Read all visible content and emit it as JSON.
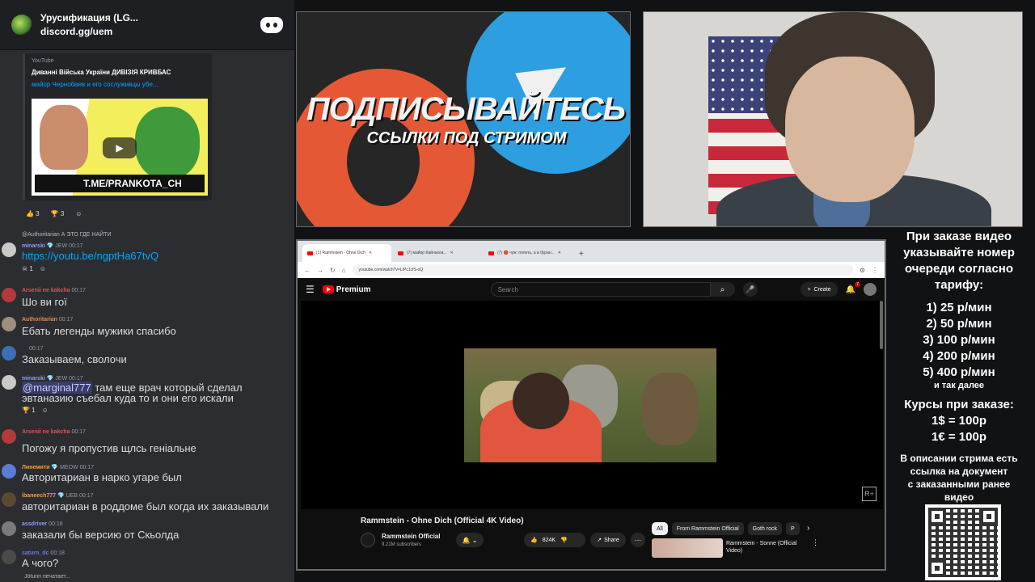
{
  "discord": {
    "server_name": "Урусификация (LG...",
    "server_link": "discord.gg/uem",
    "embed": {
      "source": "YouTube",
      "title": "Диванні Війська України ДИВІЗІЯ КРИВБАС",
      "description": "майор Чернобаев и его сослуживцы убе...",
      "banner_text": "T.ME/PRANKOTA_CH"
    },
    "embed_reactions": [
      "👍 3",
      "🏆 3",
      "☺"
    ],
    "messages": [
      {
        "reply": "@Authoritarian А ЭТО ГДЕ НАЙТИ",
        "user": "minarski",
        "badge": "💎 JEW",
        "time": "00:17",
        "text_link": "https://youtu.be/ngptHa67tvQ",
        "reactions": [
          "☠ 1",
          "☺"
        ]
      },
      {
        "user": "Arsenii ne kakcha",
        "time": "00:17",
        "text": "Шо ви гої"
      },
      {
        "user": "Authoritarian",
        "time": "00:17",
        "text": "Ебать легенды мужики спасибо"
      },
      {
        "user": "",
        "time": "00:17",
        "text": "Заказываем, сволочи"
      },
      {
        "user": "minarski",
        "badge": "💎 JEW",
        "time": "00:17",
        "mention": "@marginal777",
        "text": " там еще врач который сделал эвтаназию съебал куда то и они его искали",
        "reactions": [
          "🏆 1",
          "☺"
        ]
      },
      {
        "user": "Arsenii ne kakcha",
        "time": "00:17",
        "text": "Погожу я пропустив щлсь геніальне"
      },
      {
        "user": "Линемити",
        "badge": "💎 MEOW",
        "time": "00:17",
        "text": "Авторитариан в нарко угаре был"
      },
      {
        "user": "ibaneech777",
        "badge": "💎 UEB",
        "time": "00:17",
        "text": "авторитариан в роддоме был когда их заказывали"
      },
      {
        "user": "assdriver",
        "time": "00:18",
        "text": "заказали бы версию от Скьолда"
      },
      {
        "user": "saturn_dc",
        "time": "00:18",
        "text": "А чого?"
      }
    ],
    "typing": "Jötunn печатает..."
  },
  "banner": {
    "title": "ПОДПИСЫВАЙТЕСЬ",
    "subtitle": "ССЫЛКИ ПОД СТРИМОМ"
  },
  "browser": {
    "tabs": [
      "(1) Rammstein - Ohne Dich",
      "(7) майор Кайнахов...",
      "(7) 🔴 чуж: попеть, а в буран..."
    ],
    "url": "youtube.com/watch?v=LIPc1cfS-oQ",
    "yt": {
      "logo": "Premium",
      "search_placeholder": "Search",
      "create": "Create",
      "notif_count": "7",
      "video_title": "Rammstein - Ohne Dich (Official 4K Video)",
      "channel": "Rammstein Official",
      "subscribers": "9.21M subscribers",
      "likes": "824K",
      "share": "Share",
      "chips": [
        "All",
        "From Rammstein Official",
        "Goth rock",
        "P"
      ],
      "rec_title": "Rammstein - Sonne (Official Video)"
    }
  },
  "info": {
    "intro": [
      "При заказе видео",
      "указывайте номер",
      "очереди согласно",
      "тарифу:"
    ],
    "prices": [
      "1) 25 р/мин",
      "2) 50 р/мин",
      "3) 100 р/мин",
      "4) 200 р/мин",
      "5) 400 р/мин"
    ],
    "etc": "и так далее",
    "currency_title": "Курсы при заказе:",
    "rates": [
      "1$ = 100р",
      "1€ = 100р"
    ],
    "desc": [
      "В описании стрима есть",
      "ссылка на документ",
      "с заказанными ранее",
      "видео"
    ]
  },
  "colors": {
    "discord_bg": "#2b2d31",
    "link": "#00a8fc",
    "yt_red": "#ff0000",
    "telegram": "#2d9ee0",
    "patreon": "#f05b36"
  }
}
